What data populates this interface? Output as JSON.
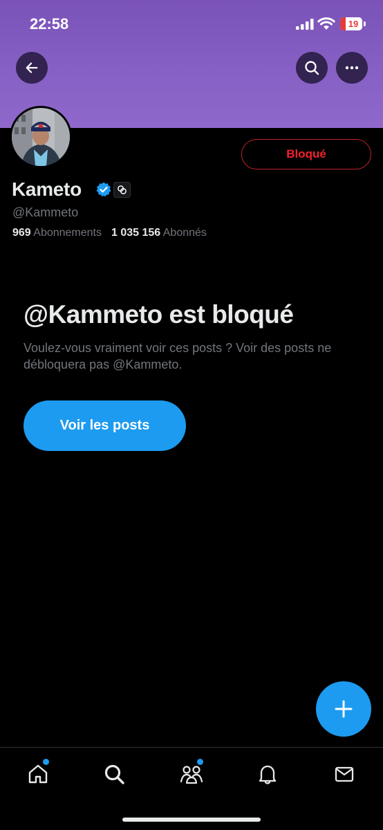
{
  "status_bar": {
    "time": "22:58",
    "battery_level": "19"
  },
  "header": {
    "back_icon": "arrow-left-icon",
    "search_icon": "search-icon",
    "more_icon": "more-horizontal-icon",
    "banner_color": "#8660c4"
  },
  "profile": {
    "display_name": "Kameto",
    "handle": "@Kammeto",
    "verified": true,
    "following_count": "969",
    "following_label": "Abonnements",
    "followers_count": "1 035 156",
    "followers_label": "Abonnés",
    "blocked_button_label": "Bloqué"
  },
  "blocked_notice": {
    "title": "@Kammeto est bloqué",
    "description": "Voulez-vous vraiment voir ces posts ? Voir des posts ne débloquera pas @Kammeto.",
    "view_posts_label": "Voir les posts"
  },
  "fab": {
    "icon": "plus-icon"
  },
  "tabbar": {
    "items": [
      {
        "name": "home",
        "icon": "home-icon",
        "badge": true
      },
      {
        "name": "search",
        "icon": "search-icon",
        "badge": false
      },
      {
        "name": "communities",
        "icon": "communities-icon",
        "badge": true
      },
      {
        "name": "notifications",
        "icon": "bell-icon",
        "badge": false
      },
      {
        "name": "messages",
        "icon": "mail-icon",
        "badge": false
      }
    ]
  },
  "colors": {
    "accent": "#1d9bf0",
    "blocked_red": "#f4212e",
    "text_primary": "#e7e9ea",
    "text_secondary": "#71767b"
  }
}
